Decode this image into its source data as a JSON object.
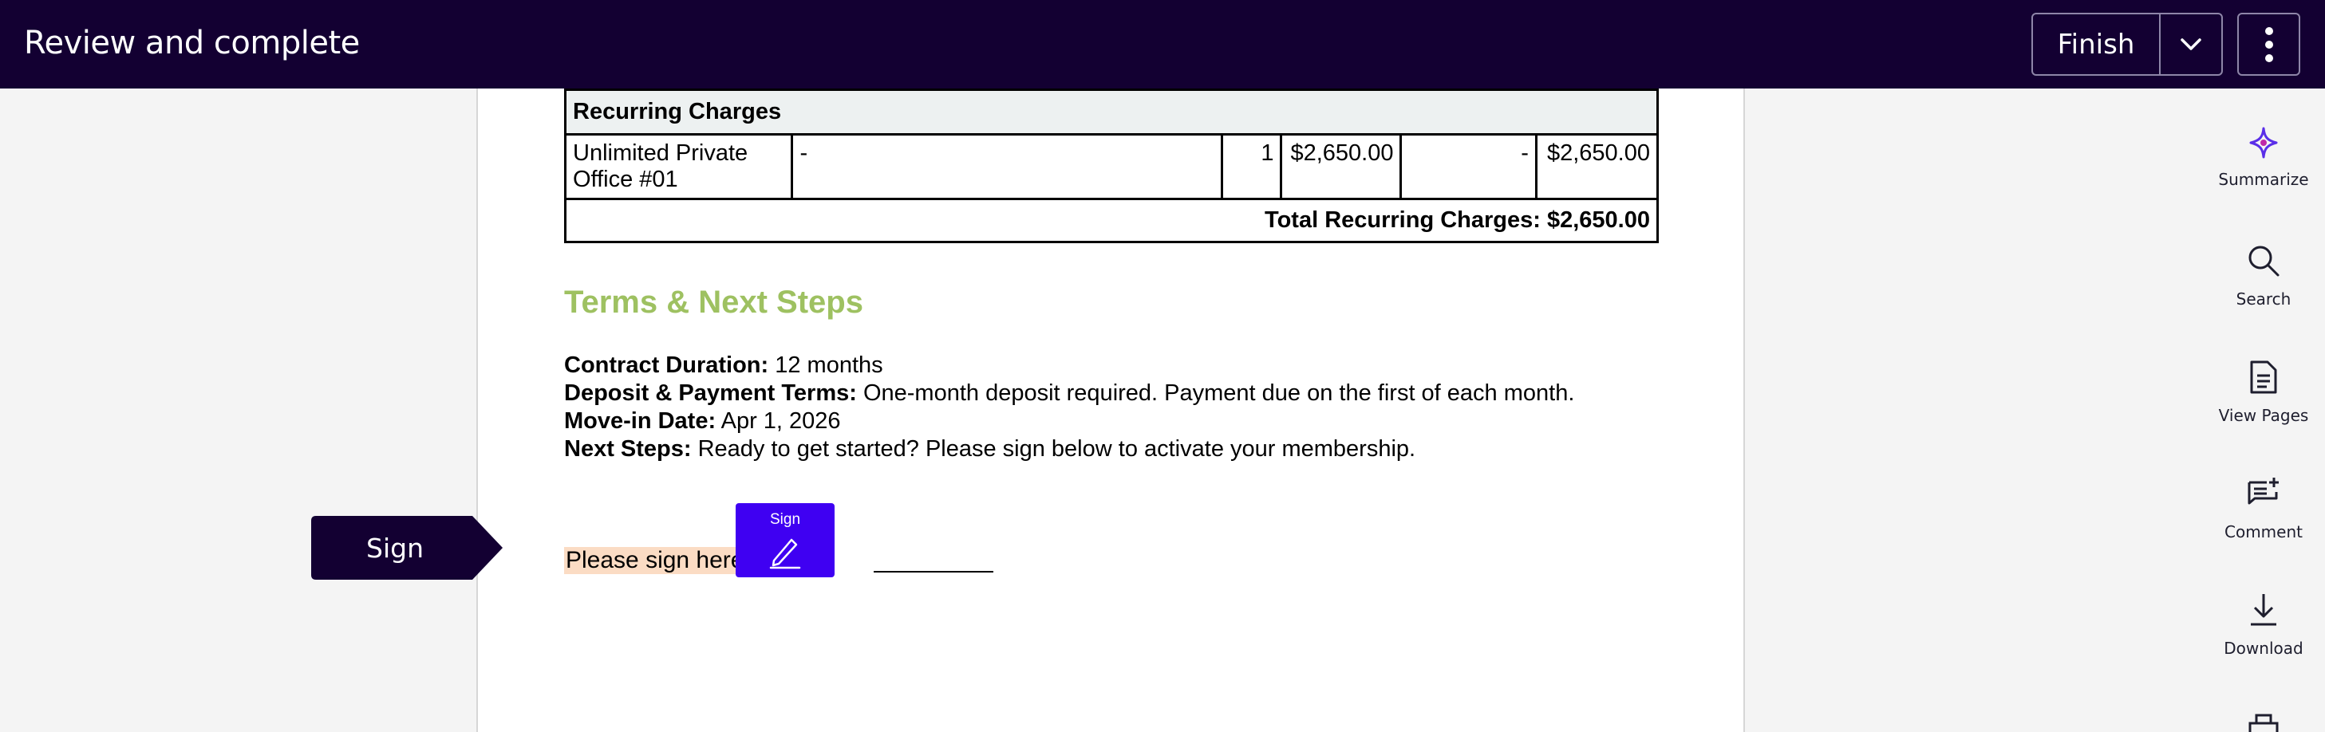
{
  "header": {
    "title": "Review and complete",
    "finish_label": "Finish"
  },
  "charges": {
    "section_label": "Recurring Charges",
    "rows": [
      {
        "name_line1": "Unlimited Private",
        "name_line2": "Office #01",
        "description": "-",
        "quantity": "1",
        "unit_price": "$2,650.00",
        "discount": "-",
        "total": "$2,650.00"
      }
    ],
    "total_label": "Total Recurring Charges: $2,650.00"
  },
  "terms": {
    "title": "Terms & Next Steps",
    "items": [
      {
        "label": "Contract Duration:",
        "value": " 12 months"
      },
      {
        "label": "Deposit & Payment Terms:",
        "value": " One-month deposit required. Payment due on the first of each month."
      },
      {
        "label": "Move-in Date:",
        "value": " Apr 1, 2026"
      },
      {
        "label": "Next Steps:",
        "value": " Ready to get started? Please sign below to activate your membership."
      }
    ]
  },
  "signature": {
    "prompt": "Please sign here:",
    "tag_label": "Sign",
    "indicator_label": "Sign"
  },
  "sidebar": {
    "items": [
      {
        "label": "Summarize",
        "icon": "sparkle-icon"
      },
      {
        "label": "Search",
        "icon": "search-icon"
      },
      {
        "label": "View Pages",
        "icon": "document-icon"
      },
      {
        "label": "Comment",
        "icon": "comment-add-icon"
      },
      {
        "label": "Download",
        "icon": "download-icon"
      }
    ]
  },
  "colors": {
    "header_bg": "#130032",
    "accent": "#3f00f2",
    "section_title": "#9ec161",
    "sign_highlight": "#fbdcc4"
  }
}
